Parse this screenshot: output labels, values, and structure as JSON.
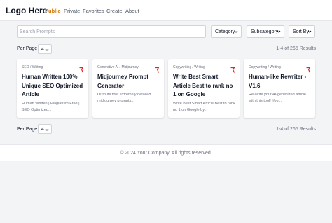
{
  "nav": {
    "logo": "Logo Here",
    "links": [
      "Public",
      "Private",
      "Favorites",
      "Create",
      "About"
    ]
  },
  "filters": {
    "search_placeholder": "Search Prompts",
    "category": "Category",
    "subcategory": "Subcategory",
    "sort": "Sort By"
  },
  "pagination": {
    "per_page_label": "Per Page",
    "per_page_value": "4",
    "results_text": "1-4 of 265 Results"
  },
  "cards": [
    {
      "category": "SEO / Writing",
      "title": "Human Written 100% Unique SEO Optimized Article",
      "description": "Human Written | Plagiarism Free | SEO Optimized..."
    },
    {
      "category": "Generative AI / Midjourney",
      "title": "Midjourney Prompt Generator",
      "description": "Outputs four extremely detailed midjourney prompts..."
    },
    {
      "category": "Copywriting / Writing",
      "title": "Write Best Smart Article Best to rank no 1 on Google",
      "description": "Write Best Smart Article Best to rank no 1 on Google by..."
    },
    {
      "category": "Copywriting / Writing",
      "title": "Human-like Rewriter - V1.6",
      "description": "Re-write your AI-generated article with this tool! You..."
    }
  ],
  "footer": {
    "text": "© 2024 Your Company. All rights reserved."
  },
  "colors": {
    "accent": "#d97706",
    "flag_red": "#e02424",
    "background": "#f3f4f6"
  }
}
